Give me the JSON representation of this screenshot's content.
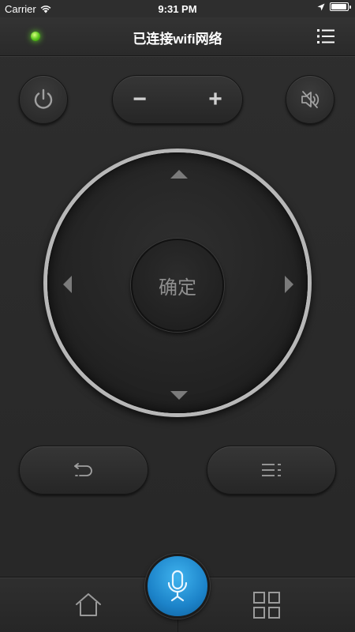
{
  "status_bar": {
    "carrier": "Carrier",
    "time": "9:31 PM"
  },
  "nav": {
    "title": "已连接wifi网络",
    "connection_led_color": "#56c21b"
  },
  "controls": {
    "volume_minus": "−",
    "volume_plus": "+",
    "ok_label": "确定"
  },
  "colors": {
    "background": "#2b2b2b",
    "mic_accent": "#1c83c9",
    "icon_gray": "#9a9a9a"
  },
  "icons": {
    "power": "power-icon",
    "mute": "mute-icon",
    "menu": "list-menu-icon",
    "back": "back-return-icon",
    "options": "options-menu-icon",
    "home": "home-icon",
    "apps": "apps-grid-icon",
    "mic": "microphone-icon"
  }
}
